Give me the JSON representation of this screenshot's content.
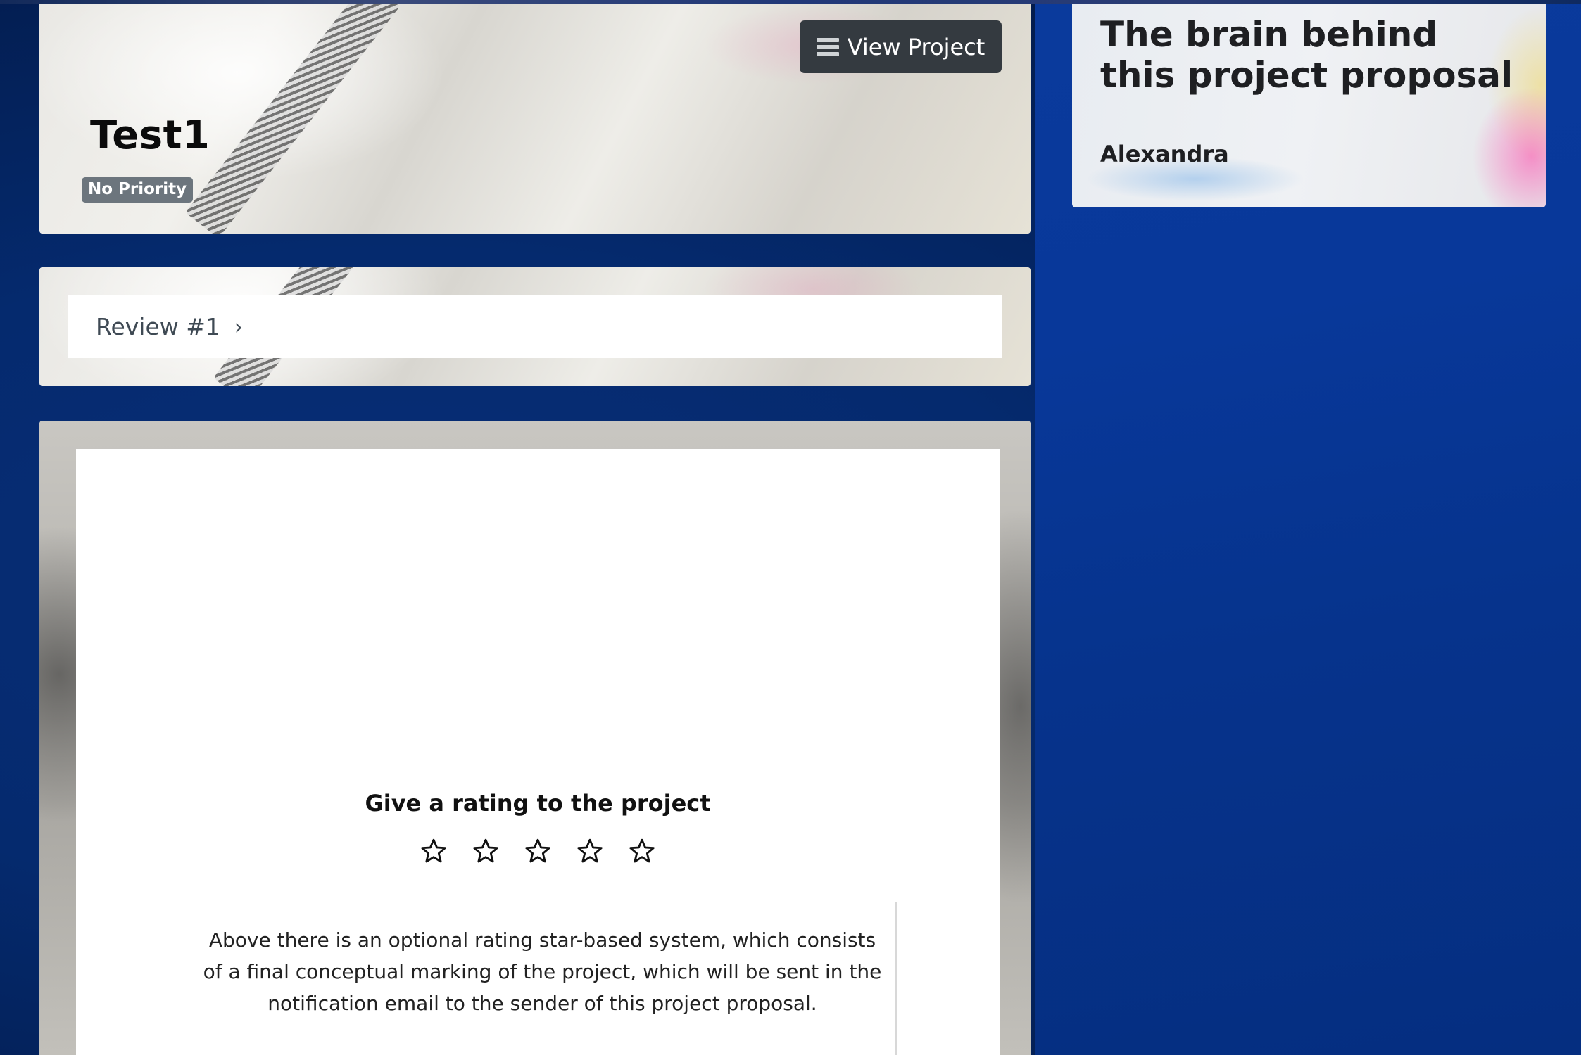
{
  "project": {
    "title": "Test1",
    "priority_badge": "No Priority",
    "view_button_label": "View Project"
  },
  "review": {
    "label": "Review #1"
  },
  "rating": {
    "heading": "Give a rating to the project",
    "stars_total": 5,
    "stars_selected": 0,
    "description": "Above there is an optional rating star-based system, which consists of a final conceptual marking of the project, which will be sent in the notification email to the sender of this project proposal."
  },
  "sidebar": {
    "title": "The brain behind this project proposal",
    "author_name": "Alexandra"
  },
  "icons": {
    "view_project": "server-stack-icon",
    "review_chevron": "chevron-right-icon",
    "rating_star": "star-outline-icon"
  },
  "colors": {
    "page_background": "#042a70",
    "badge_background": "#6c757d",
    "button_background": "#343a40"
  }
}
